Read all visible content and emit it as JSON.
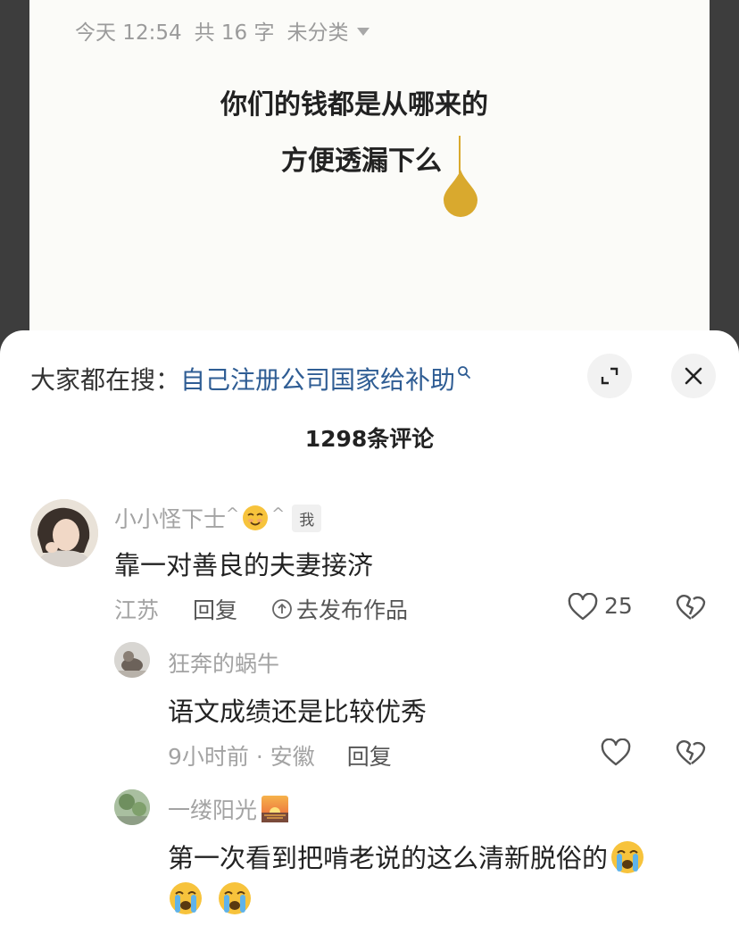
{
  "note": {
    "date": "今天 12:54",
    "word_count": "共 16 字",
    "category": "未分类",
    "line1": "你们的钱都是从哪来的",
    "line2": "方便透漏下么"
  },
  "header": {
    "search_prefix": "大家都在搜：",
    "search_query": "自己注册公司国家给补助",
    "comment_count": "1298条评论"
  },
  "comments": [
    {
      "name": "小小怪下士",
      "name_suffix_left": "^",
      "name_suffix_right": "^",
      "badge": "我",
      "text": "靠一对善良的夫妻接济",
      "location": "江苏",
      "reply_label": "回复",
      "publish_label": "去发布作品",
      "likes": "25"
    },
    {
      "name": "狂奔的蜗牛",
      "text": "语文成绩还是比较优秀",
      "time_location": "9小时前 · 安徽",
      "reply_label": "回复"
    },
    {
      "name": "一缕阳光",
      "text": "第一次看到把啃老说的这么清新脱俗的"
    }
  ],
  "colors": {
    "link": "#2f5d94",
    "accent_gold": "#d9a92e",
    "muted_text": "#a3a3a3"
  }
}
